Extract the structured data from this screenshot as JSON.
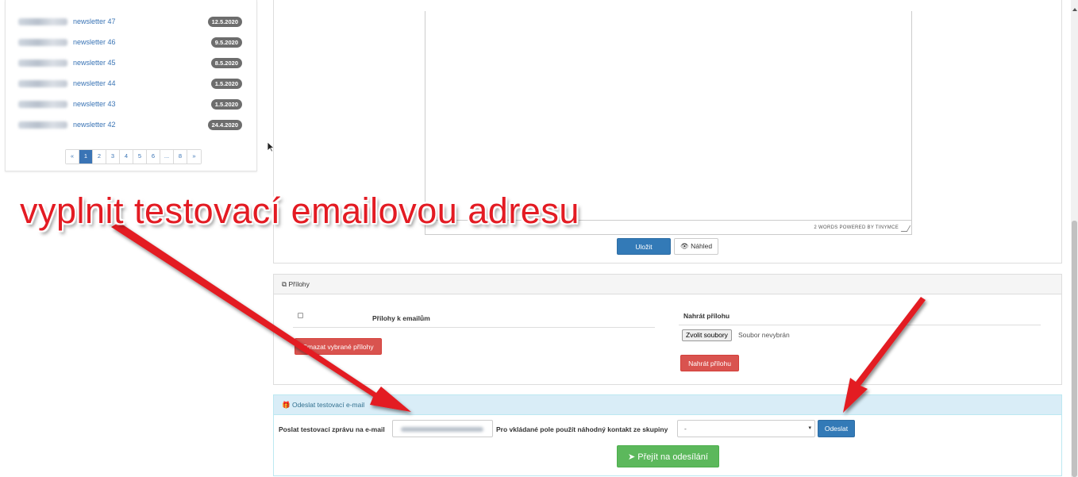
{
  "sidebar": {
    "newsletters": [
      {
        "name": "newsletter 47",
        "date": "12.5.2020"
      },
      {
        "name": "newsletter 46",
        "date": "9.5.2020"
      },
      {
        "name": "newsletter 45",
        "date": "8.5.2020"
      },
      {
        "name": "newsletter 44",
        "date": "1.5.2020"
      },
      {
        "name": "newsletter 43",
        "date": "1.5.2020"
      },
      {
        "name": "newsletter 42",
        "date": "24.4.2020"
      }
    ],
    "pagination": {
      "prev": "«",
      "pages": [
        "1",
        "2",
        "3",
        "4",
        "5",
        "6",
        "...",
        "8"
      ],
      "active": "1",
      "next": "»"
    }
  },
  "editor": {
    "status_text": "2 WORDS POWERED BY TINYMCE",
    "save_label": "Uložit",
    "preview_label": "Náhled",
    "preview_icon": "eye-icon"
  },
  "attachments": {
    "title": "Přílohy",
    "title_icon": "paperclip-icon",
    "col_email_attachments": "Přílohy k emailům",
    "delete_selected_label": "Smazat vybrané přílohy",
    "upload_title": "Nahrát přílohu",
    "choose_files_label": "Zvolit soubory",
    "no_file_text": "Soubor nevybrán",
    "upload_button_label": "Nahrát přílohu"
  },
  "test_email": {
    "title": "Odeslat testovací e-mail",
    "title_icon": "gift-icon",
    "email_label": "Poslat testovací zprávu na e-mail",
    "group_label": "Pro vkládané pole použít náhodný kontakt ze skupiny",
    "group_selected": "-",
    "send_label": "Odeslat",
    "go_to_sending_label": "Přejít na odesílání",
    "go_icon": "paper-plane-icon"
  },
  "annotation": {
    "text": "vyplnit testovací emailovou adresu",
    "color": "#e31b23"
  },
  "colors": {
    "primary": "#337ab7",
    "danger": "#d9534f",
    "success": "#5cb85c",
    "info_bg": "#d9edf7",
    "badge": "#6d6d6d"
  }
}
